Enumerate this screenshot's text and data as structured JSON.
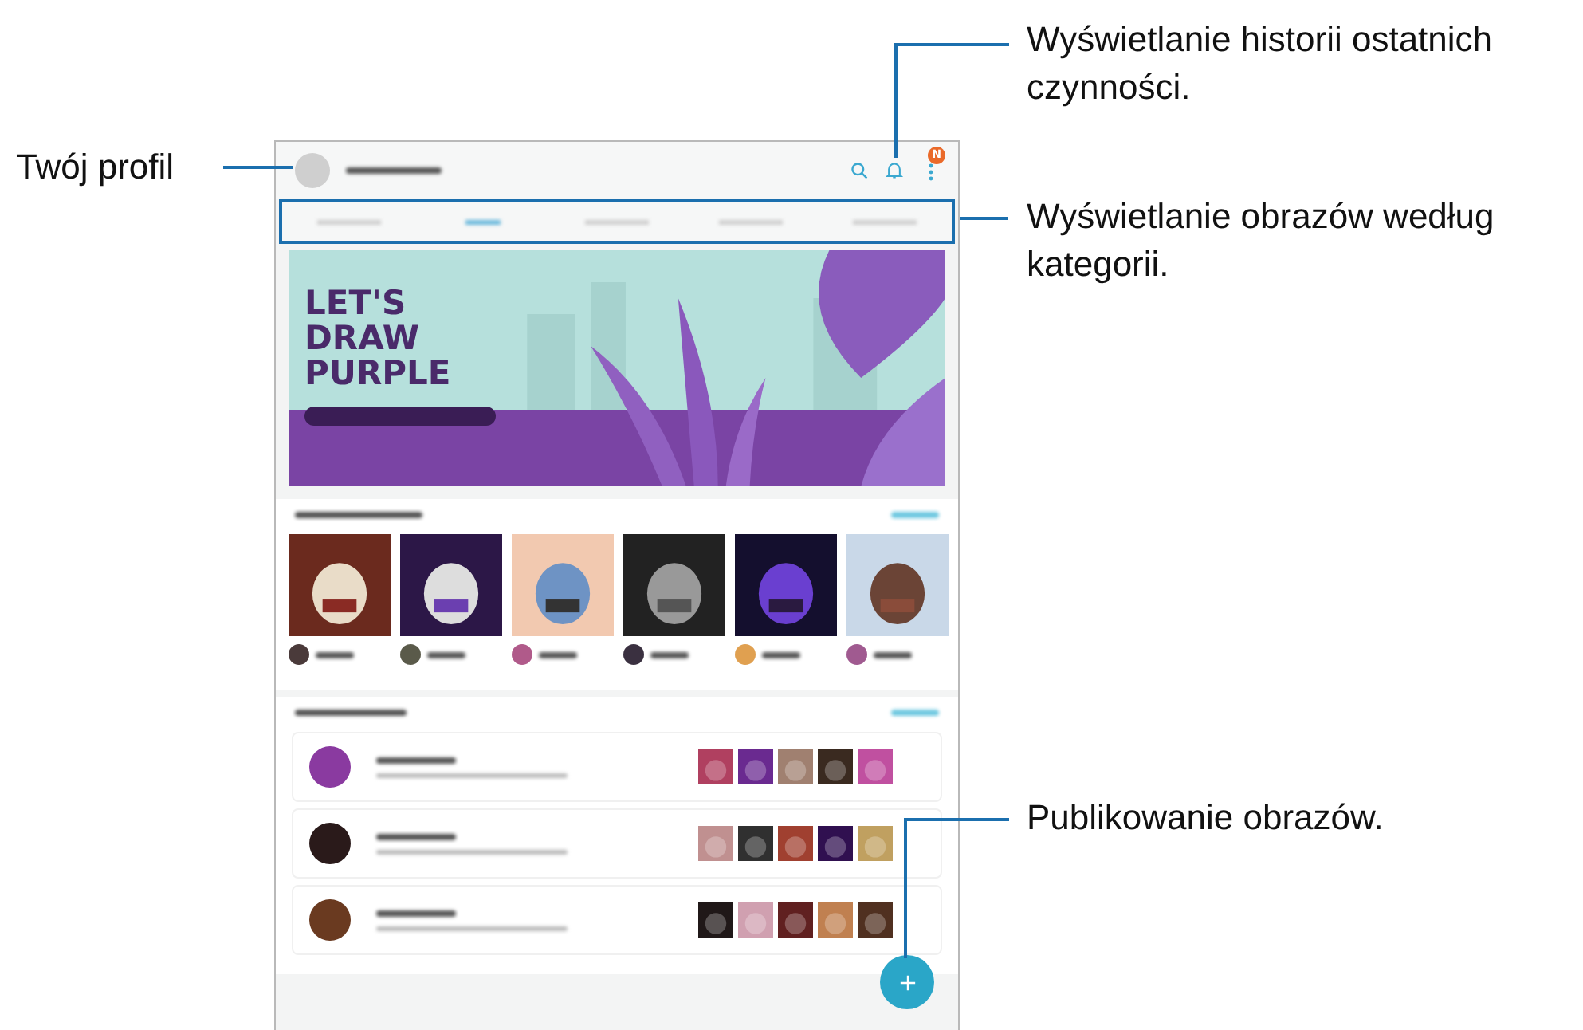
{
  "callouts": [
    {
      "kind": "profile",
      "text": "Twój profil"
    },
    {
      "kind": "history",
      "text": "Wyświetlanie historii ostatnich czynności."
    },
    {
      "kind": "categories",
      "text": "Wyświetlanie obrazów według kategorii."
    },
    {
      "kind": "publish",
      "text": "Publikowanie obrazów."
    }
  ],
  "app": {
    "notification_badge": "N",
    "tabs": [
      {
        "selected": false
      },
      {
        "selected": true
      },
      {
        "selected": false
      },
      {
        "selected": false
      },
      {
        "selected": false
      }
    ],
    "banner": {
      "title": "LET'S DRAW PURPLE"
    }
  }
}
